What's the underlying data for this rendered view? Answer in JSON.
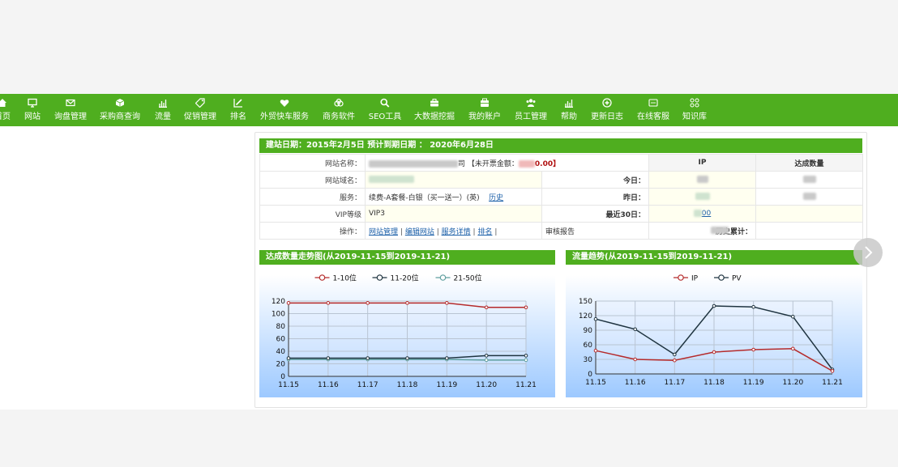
{
  "nav": {
    "items": [
      {
        "label": "首页",
        "icon": "home-icon"
      },
      {
        "label": "网站",
        "icon": "monitor-icon"
      },
      {
        "label": "询盘管理",
        "icon": "mail-icon"
      },
      {
        "label": "采购商查询",
        "icon": "cube-icon"
      },
      {
        "label": "流量",
        "icon": "bar-chart-icon"
      },
      {
        "label": "促销管理",
        "icon": "tag-icon"
      },
      {
        "label": "排名",
        "icon": "edit-chart-icon"
      },
      {
        "label": "外贸快车服务",
        "icon": "heart-icon"
      },
      {
        "label": "商务软件",
        "icon": "cloud-icon"
      },
      {
        "label": "SEO工具",
        "icon": "search-icon"
      },
      {
        "label": "大数据挖掘",
        "icon": "briefcase-icon"
      },
      {
        "label": "我的账户",
        "icon": "wallet-icon"
      },
      {
        "label": "员工管理",
        "icon": "users-icon"
      },
      {
        "label": "帮助",
        "icon": "bar-chart-icon"
      },
      {
        "label": "更新日志",
        "icon": "plus-circle-icon"
      },
      {
        "label": "在线客服",
        "icon": "chat-icon"
      },
      {
        "label": "知识库",
        "icon": "grid-icon"
      }
    ]
  },
  "site": {
    "header": "建站日期：2015年2月5日   预计到期日期 ： 2020年6月28日",
    "name_label": "网站名称：",
    "name_suffix": "司",
    "unbilled_label": "【未开票金额：",
    "unbilled_value": "0.00】",
    "domain_label": "网站域名：",
    "service_label": "服务：",
    "service_value": "续费-A套餐-白银（买一送一）(英)",
    "history_link": "历史",
    "vip_label": "VIP等级",
    "vip_value": "VIP3",
    "ops_label": "操作：",
    "ops": [
      "网站管理",
      "编辑网站",
      "服务详情",
      "排名"
    ],
    "ops_sep": "|",
    "audit_report": "审核报告"
  },
  "stats": {
    "ip_header": "IP",
    "deal_header": "达成数量",
    "today_label": "今日：",
    "yesterday_label": "昨日：",
    "last30_label": "最近30日：",
    "last30_ip": "00",
    "total_label": "历史累计："
  },
  "chart_titles": {
    "ranking": "达成数量走势图(从2019-11-15到2019-11-21)",
    "traffic": "流量趋势(从2019-11-15到2019-11-21)"
  },
  "chart_data": [
    {
      "type": "line",
      "categories": [
        "11.15",
        "11.16",
        "11.17",
        "11.18",
        "11.19",
        "11.20",
        "11.21"
      ],
      "ylim": [
        0,
        120
      ],
      "yticks": [
        0,
        20,
        40,
        60,
        80,
        100,
        120
      ],
      "legend": "top-center",
      "grid": true,
      "series": [
        {
          "name": "1-10位",
          "color": "#b52b2b",
          "values": [
            117,
            117,
            117,
            117,
            117,
            110,
            110
          ]
        },
        {
          "name": "11-20位",
          "color": "#1f3440",
          "values": [
            29,
            29,
            29,
            29,
            29,
            33,
            33
          ]
        },
        {
          "name": "21-50位",
          "color": "#5f9f9f",
          "values": [
            27,
            27,
            27,
            27,
            27,
            26,
            26
          ]
        }
      ]
    },
    {
      "type": "line",
      "categories": [
        "11.15",
        "11.16",
        "11.17",
        "11.18",
        "11.19",
        "11.20",
        "11.21"
      ],
      "ylim": [
        0,
        150
      ],
      "yticks": [
        0,
        30,
        60,
        90,
        120,
        150
      ],
      "legend": "top-center",
      "grid": true,
      "series": [
        {
          "name": "IP",
          "color": "#b52b2b",
          "values": [
            48,
            30,
            28,
            45,
            50,
            52,
            6
          ]
        },
        {
          "name": "PV",
          "color": "#1f3440",
          "values": [
            113,
            92,
            40,
            140,
            138,
            118,
            9
          ]
        }
      ]
    }
  ],
  "colors": {
    "nav_green": "#4fae1f",
    "accent_red": "#b01010"
  }
}
